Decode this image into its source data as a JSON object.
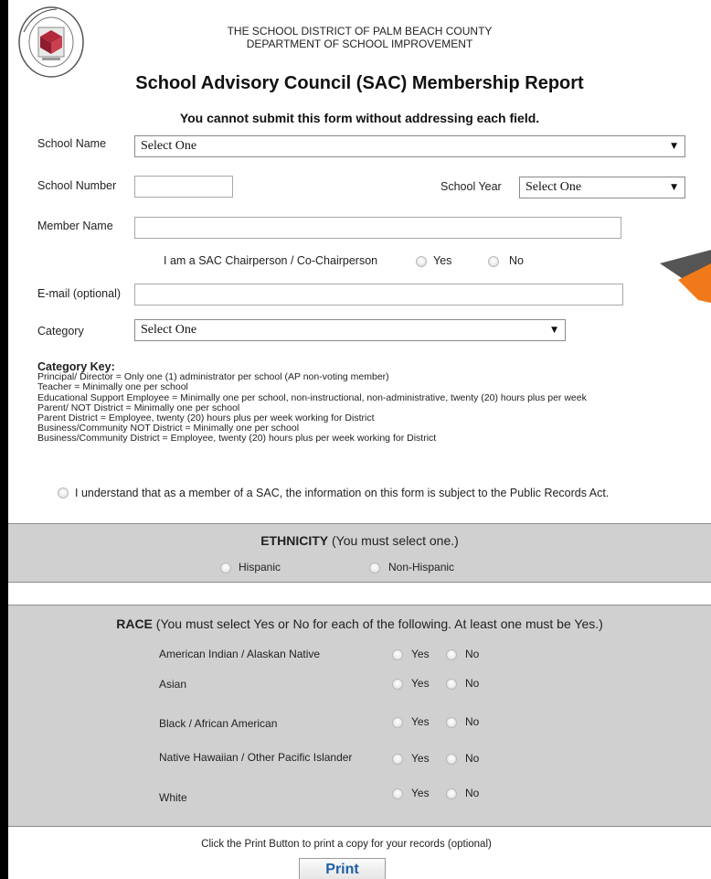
{
  "header": {
    "logo_text": "THE SCHOOL DISTRICT PALM BEACH COUNTY",
    "line1": "THE SCHOOL DISTRICT OF PALM BEACH COUNTY",
    "line2": "DEPARTMENT OF SCHOOL IMPROVEMENT",
    "title": "School Advisory Council (SAC) Membership Report",
    "notice": "You cannot submit this form without addressing each field."
  },
  "form": {
    "school_name_label": "School Name",
    "school_name_value": "Select One",
    "school_number_label": "School Number",
    "school_number_value": "",
    "school_year_label": "School Year",
    "school_year_value": "Select One",
    "member_name_label": "Member Name",
    "member_name_value": "",
    "chair_question": "I am a SAC Chairperson / Co-Chairperson",
    "chair_yes": "Yes",
    "chair_no": "No",
    "email_label": "E-mail (optional)",
    "email_value": "",
    "category_label": "Category",
    "category_value": "Select One"
  },
  "category_key": {
    "title": "Category Key:",
    "lines": [
      "Principal/ Director = Only one (1) administrator per school (AP non-voting member)",
      "Teacher = Minimally one per school",
      "Educational Support Employee = Minimally one per school, non-instructional, non-administrative, twenty (20) hours plus per week",
      "Parent/ NOT District = Minimally one per school",
      "Parent District = Employee, twenty (20) hours plus per week working for District",
      "Business/Community NOT District = Minimally one per school",
      "Business/Community District = Employee, twenty (20) hours plus per week working for District"
    ]
  },
  "acknowledge": "I understand that as a member of a SAC, the information on this form is subject to the Public Records Act.",
  "ethnicity": {
    "title_bold": "ETHNICITY",
    "title_rest": " (You must select one.)",
    "options": [
      "Hispanic",
      "Non-Hispanic"
    ]
  },
  "race": {
    "title_bold": "RACE",
    "title_rest": " (You must select Yes or No for each of the following. At least one must be Yes.)",
    "yes": "Yes",
    "no": "No",
    "rows": [
      "American Indian / Alaskan Native",
      "Asian",
      "Black / African American",
      "Native Hawaiian / Other Pacific Islander",
      "White"
    ]
  },
  "footer": {
    "print_note": "Click the Print Button to print a copy for your records (optional)",
    "print_label": "Print"
  },
  "colors": {
    "page_bg": "#ffffff",
    "outer_bg": "#000000",
    "panel_bg": "#d0d0d0",
    "logo_red": "#b0283a",
    "print_text": "#1f5fa8",
    "arrow_orange": "#f07a1a"
  }
}
